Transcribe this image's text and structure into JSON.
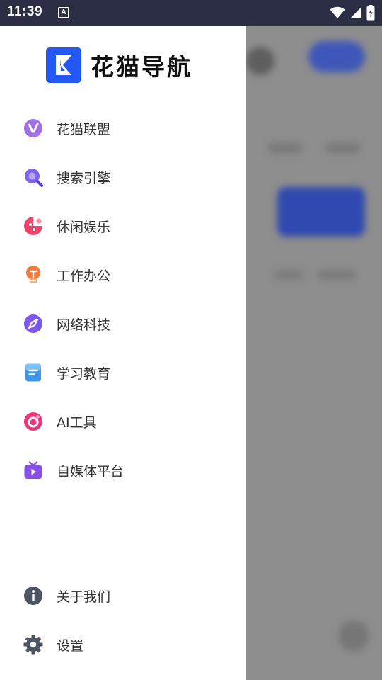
{
  "status_bar": {
    "time": "11:39",
    "notification_icon": "A"
  },
  "brand": {
    "title": "花猫导航",
    "logo_icon": "k-logo-icon",
    "accent": "#2458f5"
  },
  "menu": {
    "categories": [
      {
        "label": "花猫联盟",
        "icon": "v-badge-icon",
        "color": "#9b6ae8"
      },
      {
        "label": "搜索引擎",
        "icon": "search-icon",
        "color": "#7a5cf0"
      },
      {
        "label": "休闲娱乐",
        "icon": "game-icon",
        "color": "#f0456b"
      },
      {
        "label": "工作办公",
        "icon": "lightbulb-icon",
        "color": "#f37a3f"
      },
      {
        "label": "网络科技",
        "icon": "compass-icon",
        "color": "#7b56ef"
      },
      {
        "label": "学习教育",
        "icon": "document-icon",
        "color": "#3e97ef"
      },
      {
        "label": "AI工具",
        "icon": "ring-icon",
        "color": "#f0367a"
      },
      {
        "label": "自媒体平台",
        "icon": "tv-play-icon",
        "color": "#8a4fe9"
      }
    ],
    "footer": [
      {
        "label": "关于我们",
        "icon": "info-icon",
        "color": "#4d5562"
      },
      {
        "label": "设置",
        "icon": "gear-icon",
        "color": "#4d5562"
      }
    ]
  }
}
